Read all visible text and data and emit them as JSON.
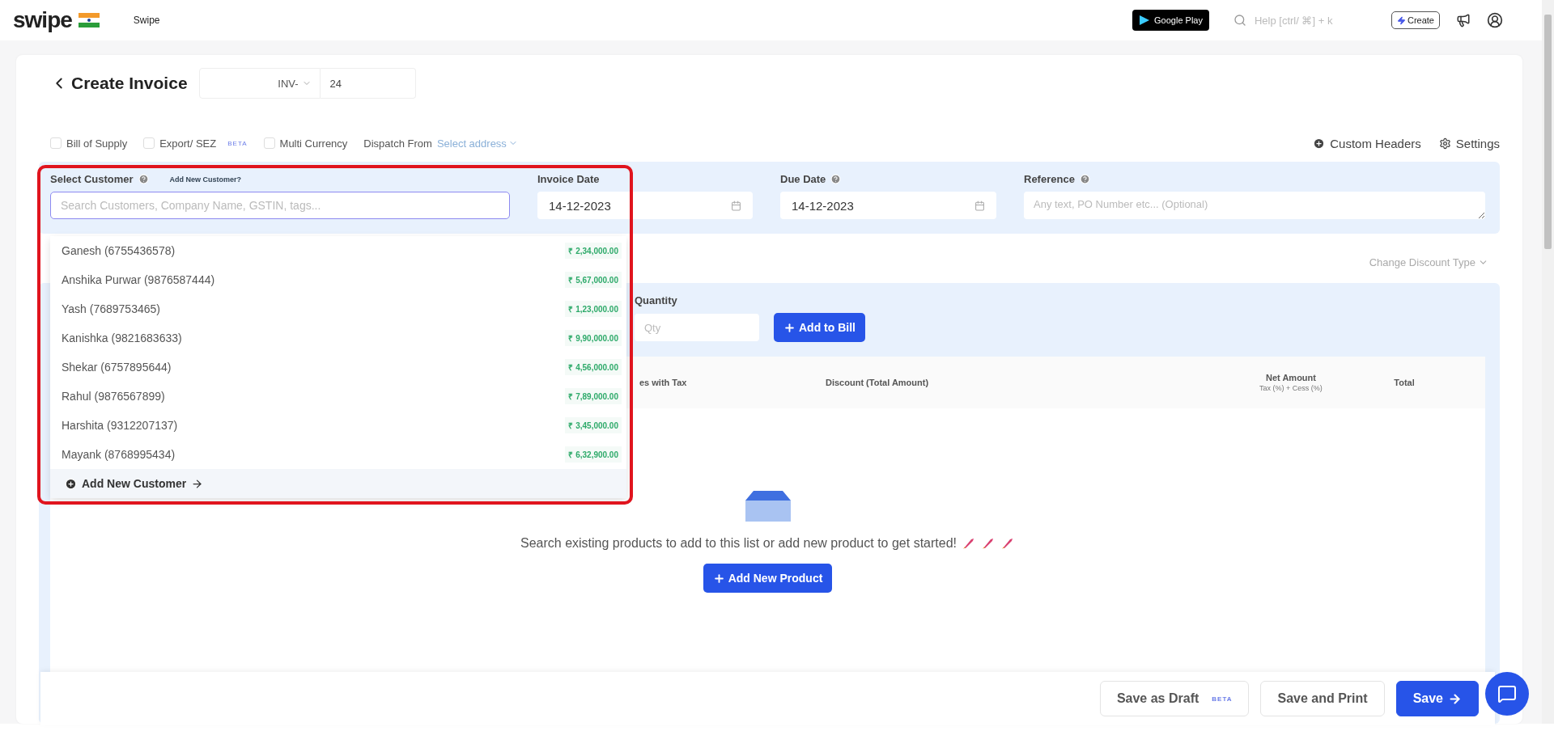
{
  "topbar": {
    "logo": "swipe",
    "company": "Swipe",
    "store_badge": "Google Play",
    "search": {
      "placeholder": "Help [ctrl/ ⌘] + k"
    },
    "create_button": "Create"
  },
  "header": {
    "title": "Create Invoice",
    "prefix": "INV-",
    "number": "24"
  },
  "options": [
    {
      "label": "Bill of Supply",
      "checked": false
    },
    {
      "label": "Export/ SEZ",
      "badge": "BETA",
      "checked": false
    },
    {
      "label": "Multi Currency",
      "checked": false
    }
  ],
  "dispatch": {
    "label": "Dispatch From",
    "value": "Select address"
  },
  "header_links": [
    {
      "kind": "plus",
      "label": "Custom Headers"
    },
    {
      "kind": "gear",
      "label": "Settings"
    }
  ],
  "customer_panel": {
    "customer_label": "Select Customer",
    "add_link": "Add New Customer?",
    "search": {
      "placeholder": "Search Customers, Company Name, GSTIN, tags..."
    },
    "invoice_date": {
      "label": "Invoice Date",
      "value": "14-12-2023"
    },
    "due_date": {
      "label": "Due Date",
      "value": "14-12-2023"
    },
    "reference": {
      "label": "Reference",
      "placeholder": "Any text, PO Number etc... (Optional)"
    }
  },
  "customer_dropdown": {
    "items": [
      {
        "name": "Ganesh (6755436578)",
        "amount": "₹ 2,34,000.00"
      },
      {
        "name": "Anshika Purwar (9876587444)",
        "amount": "₹ 5,67,000.00"
      },
      {
        "name": "Yash (7689753465)",
        "amount": "₹ 1,23,000.00"
      },
      {
        "name": "Kanishka (9821683633)",
        "amount": "₹ 9,90,000.00"
      },
      {
        "name": "Shekar (6757895644)",
        "amount": "₹ 4,56,000.00"
      },
      {
        "name": "Rahul (9876567899)",
        "amount": "₹ 7,89,000.00"
      },
      {
        "name": "Harshita (9312207137)",
        "amount": "₹ 3,45,000.00"
      },
      {
        "name": "Mayank (8768995434)",
        "amount": "₹ 6,32,900.00"
      }
    ],
    "add_new": "Add New Customer"
  },
  "discount_type": "Change Discount Type",
  "products": {
    "quantity_label": "Quantity",
    "quantity": {
      "placeholder": "Qty"
    },
    "add_button": "Add to Bill",
    "columns": [
      {
        "label": "es with Tax"
      },
      {
        "label": "Discount (Total Amount)"
      },
      {
        "label": "Net Amount",
        "sub": "Tax (%) + Cess (%)"
      },
      {
        "label": "Total"
      }
    ],
    "empty_text": "Search existing products to add to this list or add new product to get started!",
    "add_product": "Add New Product"
  },
  "footer": {
    "buttons": [
      {
        "kind": "outline",
        "label": "Save as Draft",
        "badge": "BETA"
      },
      {
        "kind": "outline",
        "label": "Save and Print"
      },
      {
        "kind": "primary",
        "label": "Save"
      }
    ]
  }
}
